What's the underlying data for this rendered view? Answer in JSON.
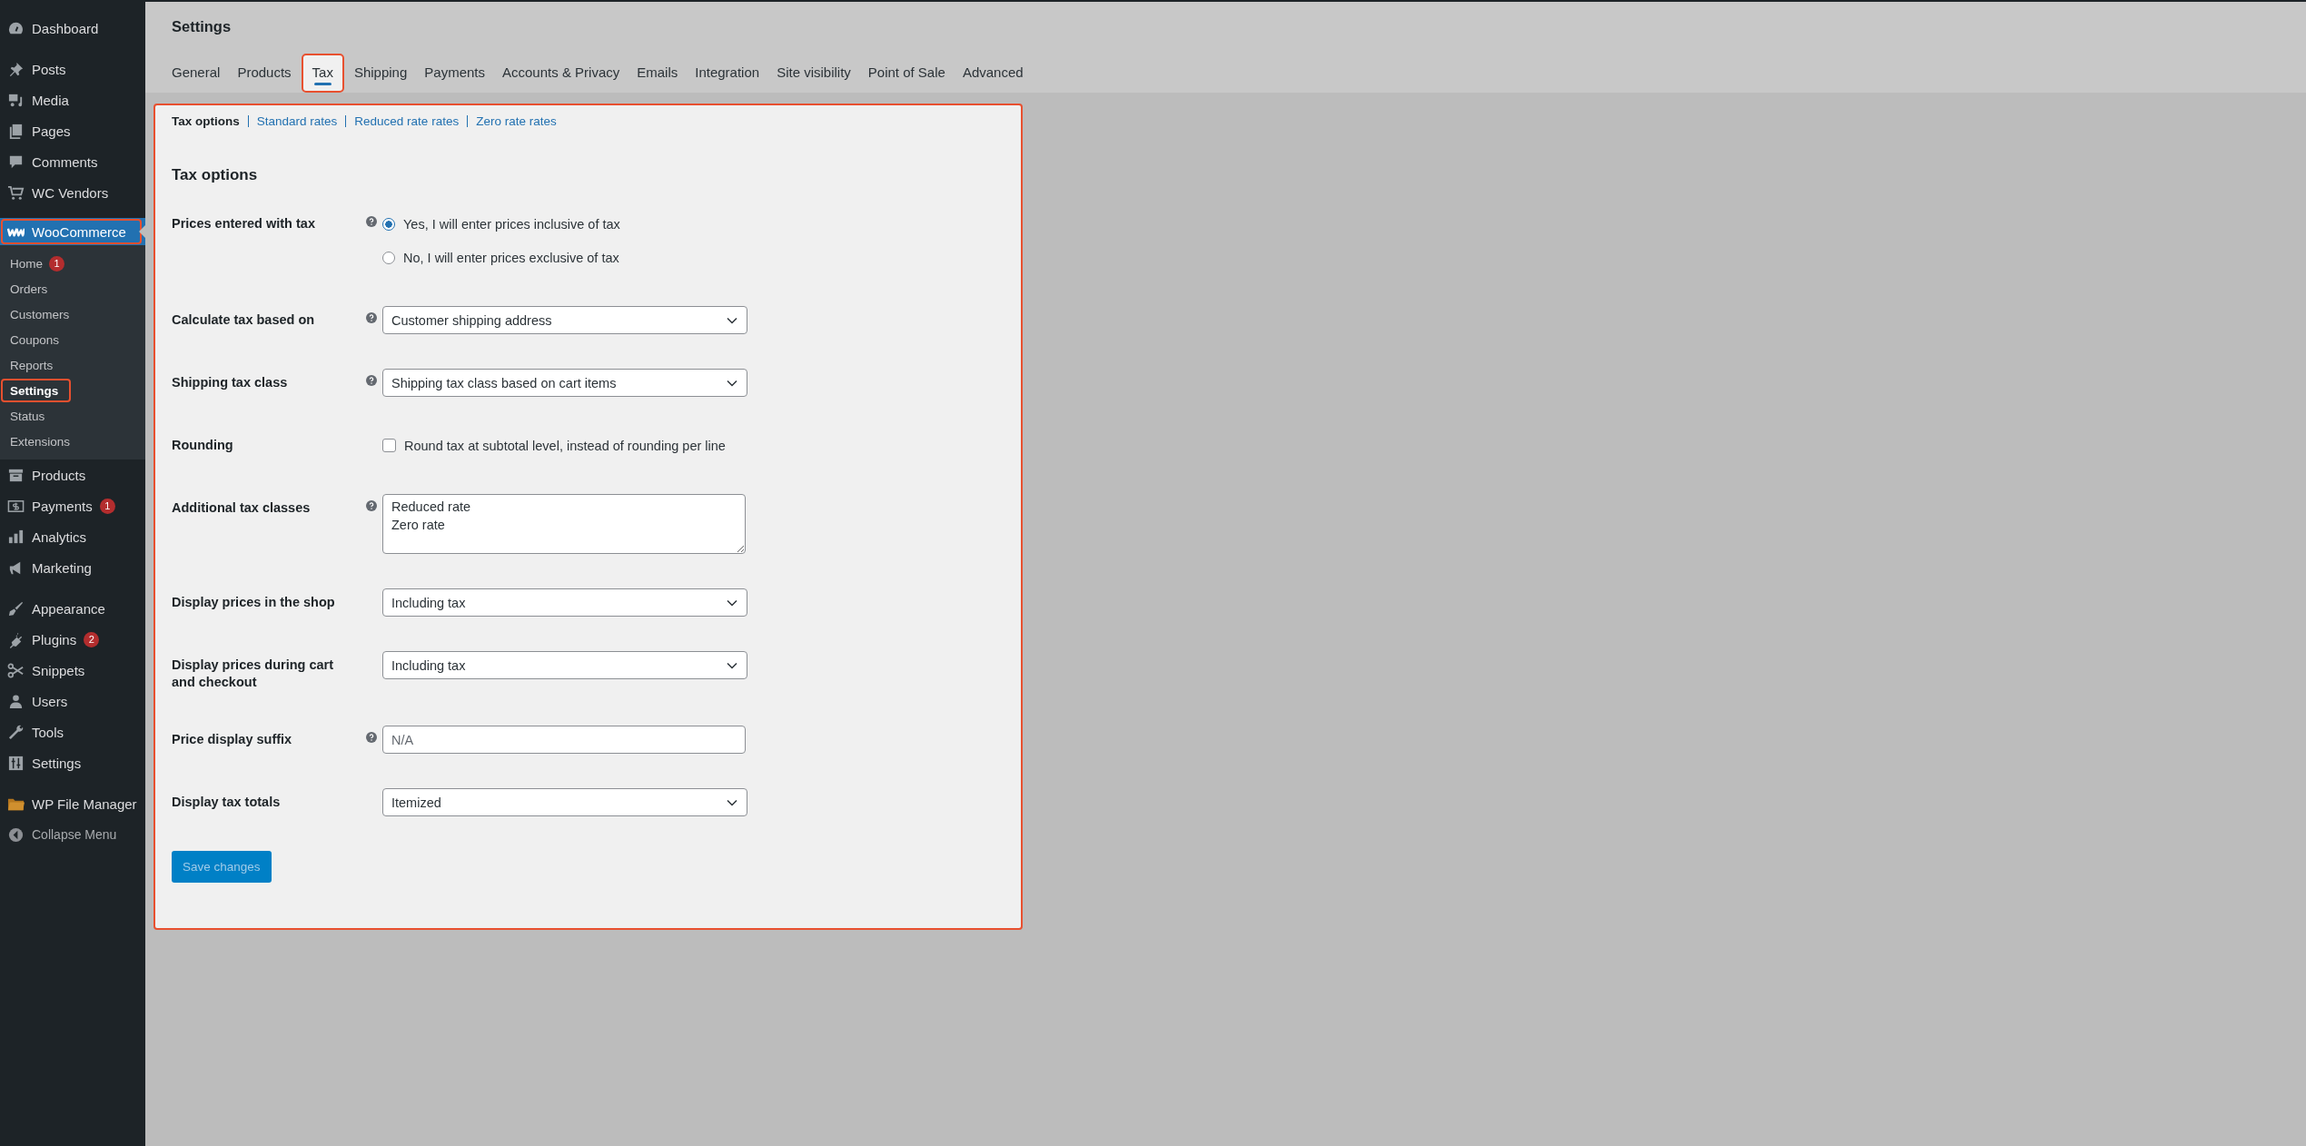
{
  "sidebar": {
    "groups": [
      [
        {
          "label": "Dashboard",
          "selected": false,
          "highlighted": false
        }
      ],
      [
        {
          "label": "Posts",
          "selected": false,
          "highlighted": false
        },
        {
          "label": "Media",
          "selected": false,
          "highlighted": false
        },
        {
          "label": "Pages",
          "selected": false,
          "highlighted": false
        },
        {
          "label": "Comments",
          "selected": false,
          "highlighted": false
        },
        {
          "label": "WC Vendors",
          "selected": false,
          "highlighted": false
        }
      ],
      [
        {
          "label": "WooCommerce",
          "selected": true,
          "highlighted": true,
          "children": [
            {
              "label": "Home",
              "badge": "1",
              "selected": false,
              "highlighted": false
            },
            {
              "label": "Orders",
              "selected": false,
              "highlighted": false
            },
            {
              "label": "Customers",
              "selected": false,
              "highlighted": false
            },
            {
              "label": "Coupons",
              "selected": false,
              "highlighted": false
            },
            {
              "label": "Reports",
              "selected": false,
              "highlighted": false
            },
            {
              "label": "Settings",
              "selected": true,
              "highlighted": true
            },
            {
              "label": "Status",
              "selected": false,
              "highlighted": false
            },
            {
              "label": "Extensions",
              "selected": false,
              "highlighted": false
            }
          ]
        },
        {
          "label": "Products",
          "selected": false,
          "highlighted": false
        },
        {
          "label": "Payments",
          "badge": "1",
          "selected": false,
          "highlighted": false
        },
        {
          "label": "Analytics",
          "selected": false,
          "highlighted": false
        },
        {
          "label": "Marketing",
          "selected": false,
          "highlighted": false
        }
      ],
      [
        {
          "label": "Appearance",
          "selected": false,
          "highlighted": false
        },
        {
          "label": "Plugins",
          "badge": "2",
          "selected": false,
          "highlighted": false
        },
        {
          "label": "Snippets",
          "selected": false,
          "highlighted": false
        },
        {
          "label": "Users",
          "selected": false,
          "highlighted": false
        },
        {
          "label": "Tools",
          "selected": false,
          "highlighted": false
        },
        {
          "label": "Settings",
          "selected": false,
          "highlighted": false
        }
      ],
      [
        {
          "label": "WP File Manager",
          "selected": false,
          "highlighted": false
        },
        {
          "label": "Collapse Menu",
          "selected": false,
          "highlighted": false
        }
      ]
    ]
  },
  "page": {
    "title": "Settings"
  },
  "tabs": [
    {
      "label": "General",
      "selected": false,
      "highlighted": false
    },
    {
      "label": "Products",
      "selected": false,
      "highlighted": false
    },
    {
      "label": "Tax",
      "selected": true,
      "highlighted": true
    },
    {
      "label": "Shipping",
      "selected": false,
      "highlighted": false
    },
    {
      "label": "Payments",
      "selected": false,
      "highlighted": false
    },
    {
      "label": "Accounts & Privacy",
      "selected": false,
      "highlighted": false
    },
    {
      "label": "Emails",
      "selected": false,
      "highlighted": false
    },
    {
      "label": "Integration",
      "selected": false,
      "highlighted": false
    },
    {
      "label": "Site visibility",
      "selected": false,
      "highlighted": false
    },
    {
      "label": "Point of Sale",
      "selected": false,
      "highlighted": false
    },
    {
      "label": "Advanced",
      "selected": false,
      "highlighted": false
    }
  ],
  "panel": {
    "highlighted": true,
    "subnav": [
      {
        "label": "Tax options",
        "selected": true
      },
      {
        "label": "Standard rates",
        "selected": false
      },
      {
        "label": "Reduced rate rates",
        "selected": false
      },
      {
        "label": "Zero rate rates",
        "selected": false
      }
    ],
    "heading": "Tax options",
    "rows": [
      {
        "label": "Prices entered with tax",
        "help": true,
        "kind": "radio",
        "options": [
          {
            "label": "Yes, I will enter prices inclusive of tax",
            "selected": true
          },
          {
            "label": "No, I will enter prices exclusive of tax",
            "selected": false
          }
        ]
      },
      {
        "label": "Calculate tax based on",
        "help": true,
        "kind": "select",
        "value": "Customer shipping address"
      },
      {
        "label": "Shipping tax class",
        "help": true,
        "kind": "select",
        "value": "Shipping tax class based on cart items"
      },
      {
        "label": "Rounding",
        "help": false,
        "kind": "checkbox",
        "text": "Round tax at subtotal level, instead of rounding per line",
        "checked": false
      },
      {
        "label": "Additional tax classes",
        "help": true,
        "kind": "textarea",
        "value": "Reduced rate\nZero rate"
      },
      {
        "label": "Display prices in the shop",
        "help": false,
        "kind": "select",
        "value": "Including tax"
      },
      {
        "label": "Display prices during cart and checkout",
        "help": false,
        "kind": "select",
        "value": "Including tax"
      },
      {
        "label": "Price display suffix",
        "help": true,
        "kind": "text",
        "placeholder": "N/A"
      },
      {
        "label": "Display tax totals",
        "help": false,
        "kind": "select",
        "value": "Itemized"
      }
    ],
    "save_button": {
      "label": "Save changes",
      "disabled": true
    }
  }
}
